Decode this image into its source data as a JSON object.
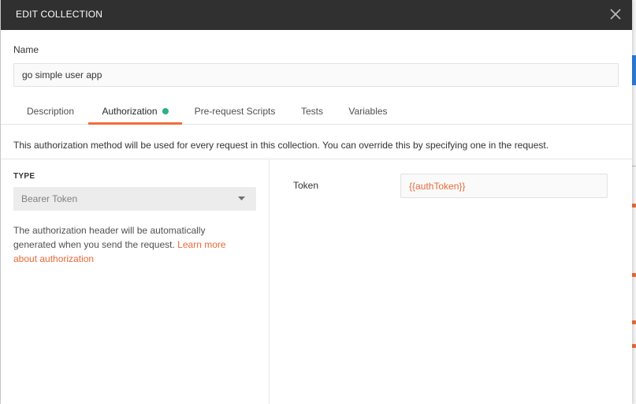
{
  "modal": {
    "title": "EDIT COLLECTION"
  },
  "name_field": {
    "label": "Name",
    "value": "go simple user app"
  },
  "tabs": [
    {
      "label": "Description",
      "active": false
    },
    {
      "label": "Authorization",
      "active": true,
      "has_indicator": true
    },
    {
      "label": "Pre-request Scripts",
      "active": false
    },
    {
      "label": "Tests",
      "active": false
    },
    {
      "label": "Variables",
      "active": false
    }
  ],
  "auth": {
    "info": "This authorization method will be used for every request in this collection. You can override this by specifying one in the request.",
    "type_label": "TYPE",
    "type_value": "Bearer Token",
    "help_text": "The authorization header will be automatically generated when you send the request.",
    "help_link": "Learn more about authorization",
    "token_label": "Token",
    "token_value": "{{authToken}}"
  },
  "icons": {
    "close": "close-icon",
    "caret": "caret-down-icon",
    "indicator": "status-dot-icon"
  },
  "colors": {
    "header_bg": "#303030",
    "accent": "#f26b3a",
    "link": "#e8693a",
    "indicator": "#26b47f"
  }
}
